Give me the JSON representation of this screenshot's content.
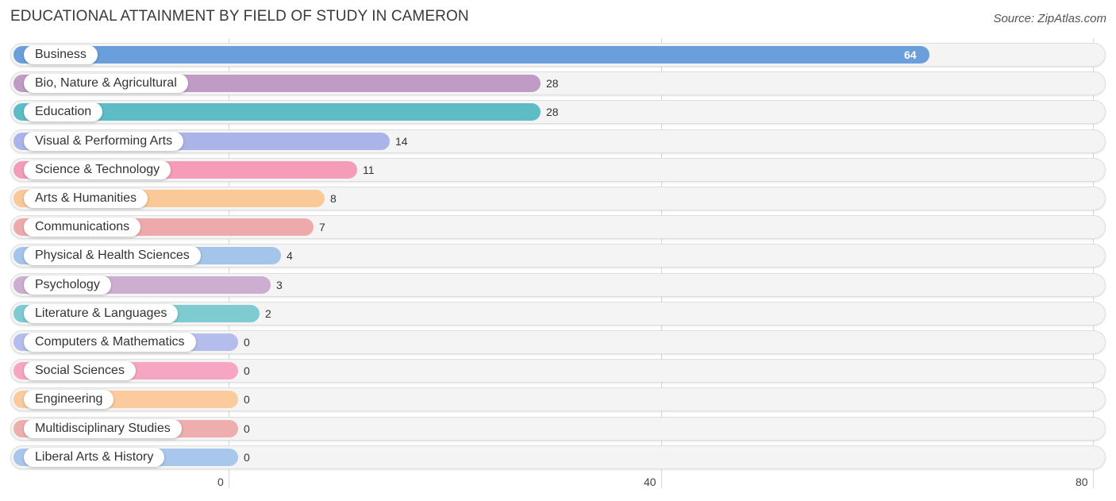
{
  "header": {
    "title": "EDUCATIONAL ATTAINMENT BY FIELD OF STUDY IN CAMERON",
    "source": "Source: ZipAtlas.com"
  },
  "chart_data": {
    "type": "bar",
    "orientation": "horizontal",
    "title": "EDUCATIONAL ATTAINMENT BY FIELD OF STUDY IN CAMERON",
    "xlabel": "",
    "ylabel": "",
    "xlim": [
      0,
      80
    ],
    "xticks": [
      "0",
      "40",
      "80"
    ],
    "grid": true,
    "categories": [
      "Business",
      "Bio, Nature & Agricultural",
      "Education",
      "Visual & Performing Arts",
      "Science & Technology",
      "Arts & Humanities",
      "Communications",
      "Physical & Health Sciences",
      "Psychology",
      "Literature & Languages",
      "Computers & Mathematics",
      "Social Sciences",
      "Engineering",
      "Multidisciplinary Studies",
      "Liberal Arts & History"
    ],
    "values": [
      64,
      28,
      28,
      14,
      11,
      8,
      7,
      4,
      3,
      2,
      0,
      0,
      0,
      0,
      0
    ],
    "value_labels": [
      "64",
      "28",
      "28",
      "14",
      "11",
      "8",
      "7",
      "4",
      "3",
      "2",
      "0",
      "0",
      "0",
      "0",
      "0"
    ],
    "colors": [
      "#6a9fdb",
      "#c09bc6",
      "#5ebcc7",
      "#aab4e8",
      "#f49cb8",
      "#fbc898",
      "#eeaaaa",
      "#a5c4ea",
      "#cdaed0",
      "#7ecbd2",
      "#b5bdec",
      "#f6a6c2",
      "#fbcb9e",
      "#efaeae",
      "#a9c6ec"
    ]
  }
}
